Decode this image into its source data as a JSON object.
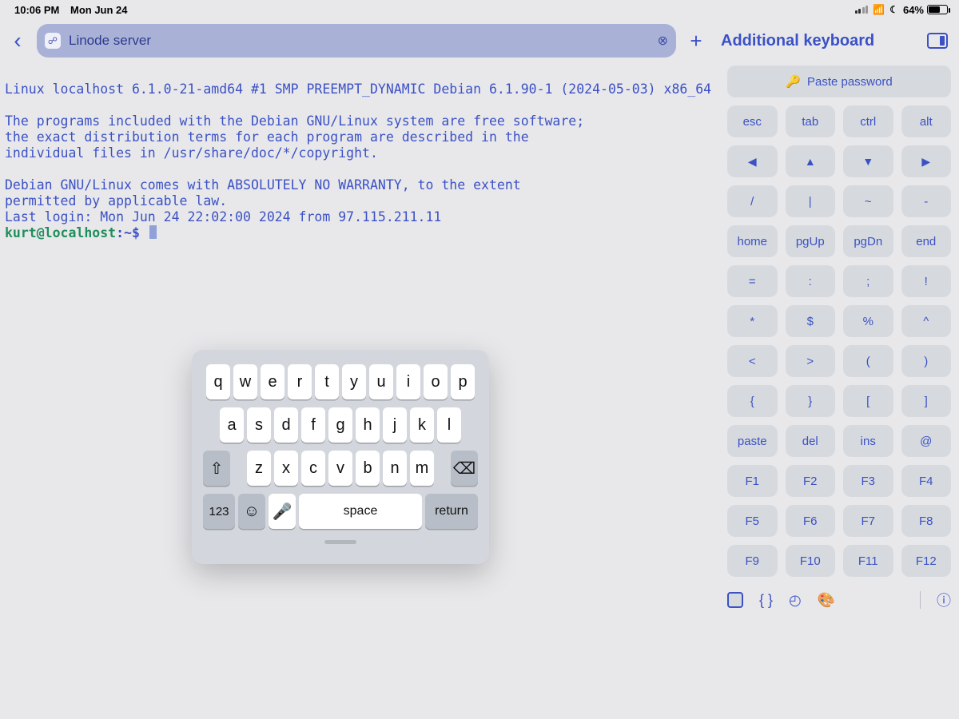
{
  "statusbar": {
    "time": "10:06 PM",
    "date": "Mon Jun 24",
    "battery_pct": "64%"
  },
  "header": {
    "tab_label": "Linode server",
    "sidebar_title": "Additional keyboard"
  },
  "terminal": {
    "line1": "Linux localhost 6.1.0-21-amd64 #1 SMP PREEMPT_DYNAMIC Debian 6.1.90-1 (2024-05-03) x86_64",
    "para1_l1": "The programs included with the Debian GNU/Linux system are free software;",
    "para1_l2": "the exact distribution terms for each program are described in the",
    "para1_l3": "individual files in /usr/share/doc/*/copyright.",
    "para2_l1": "Debian GNU/Linux comes with ABSOLUTELY NO WARRANTY, to the extent",
    "para2_l2": "permitted by applicable law.",
    "lastlogin": "Last login: Mon Jun 24 22:02:00 2024 from 97.115.211.11",
    "prompt_user": "kurt@localhost",
    "prompt_path": "~",
    "prompt_sym": "$"
  },
  "side": {
    "paste_label": "Paste password",
    "rows": [
      [
        "esc",
        "tab",
        "ctrl",
        "alt"
      ],
      [
        "◀",
        "▲",
        "▼",
        "▶"
      ],
      [
        "/",
        "|",
        "~",
        "-"
      ],
      [
        "home",
        "pgUp",
        "pgDn",
        "end"
      ],
      [
        "=",
        ":",
        ";",
        "!"
      ],
      [
        "*",
        "$",
        "%",
        "^"
      ],
      [
        "<",
        ">",
        "(",
        ")"
      ],
      [
        "{",
        "}",
        "[",
        "]"
      ],
      [
        "paste",
        "del",
        "ins",
        "@"
      ],
      [
        "F1",
        "F2",
        "F3",
        "F4"
      ],
      [
        "F5",
        "F6",
        "F7",
        "F8"
      ],
      [
        "F9",
        "F10",
        "F11",
        "F12"
      ]
    ]
  },
  "ios_keyboard": {
    "row1": [
      "q",
      "w",
      "e",
      "r",
      "t",
      "y",
      "u",
      "i",
      "o",
      "p"
    ],
    "row2": [
      "a",
      "s",
      "d",
      "f",
      "g",
      "h",
      "j",
      "k",
      "l"
    ],
    "row3": [
      "z",
      "x",
      "c",
      "v",
      "b",
      "n",
      "m"
    ],
    "nums_label": "123",
    "space_label": "space",
    "return_label": "return"
  }
}
